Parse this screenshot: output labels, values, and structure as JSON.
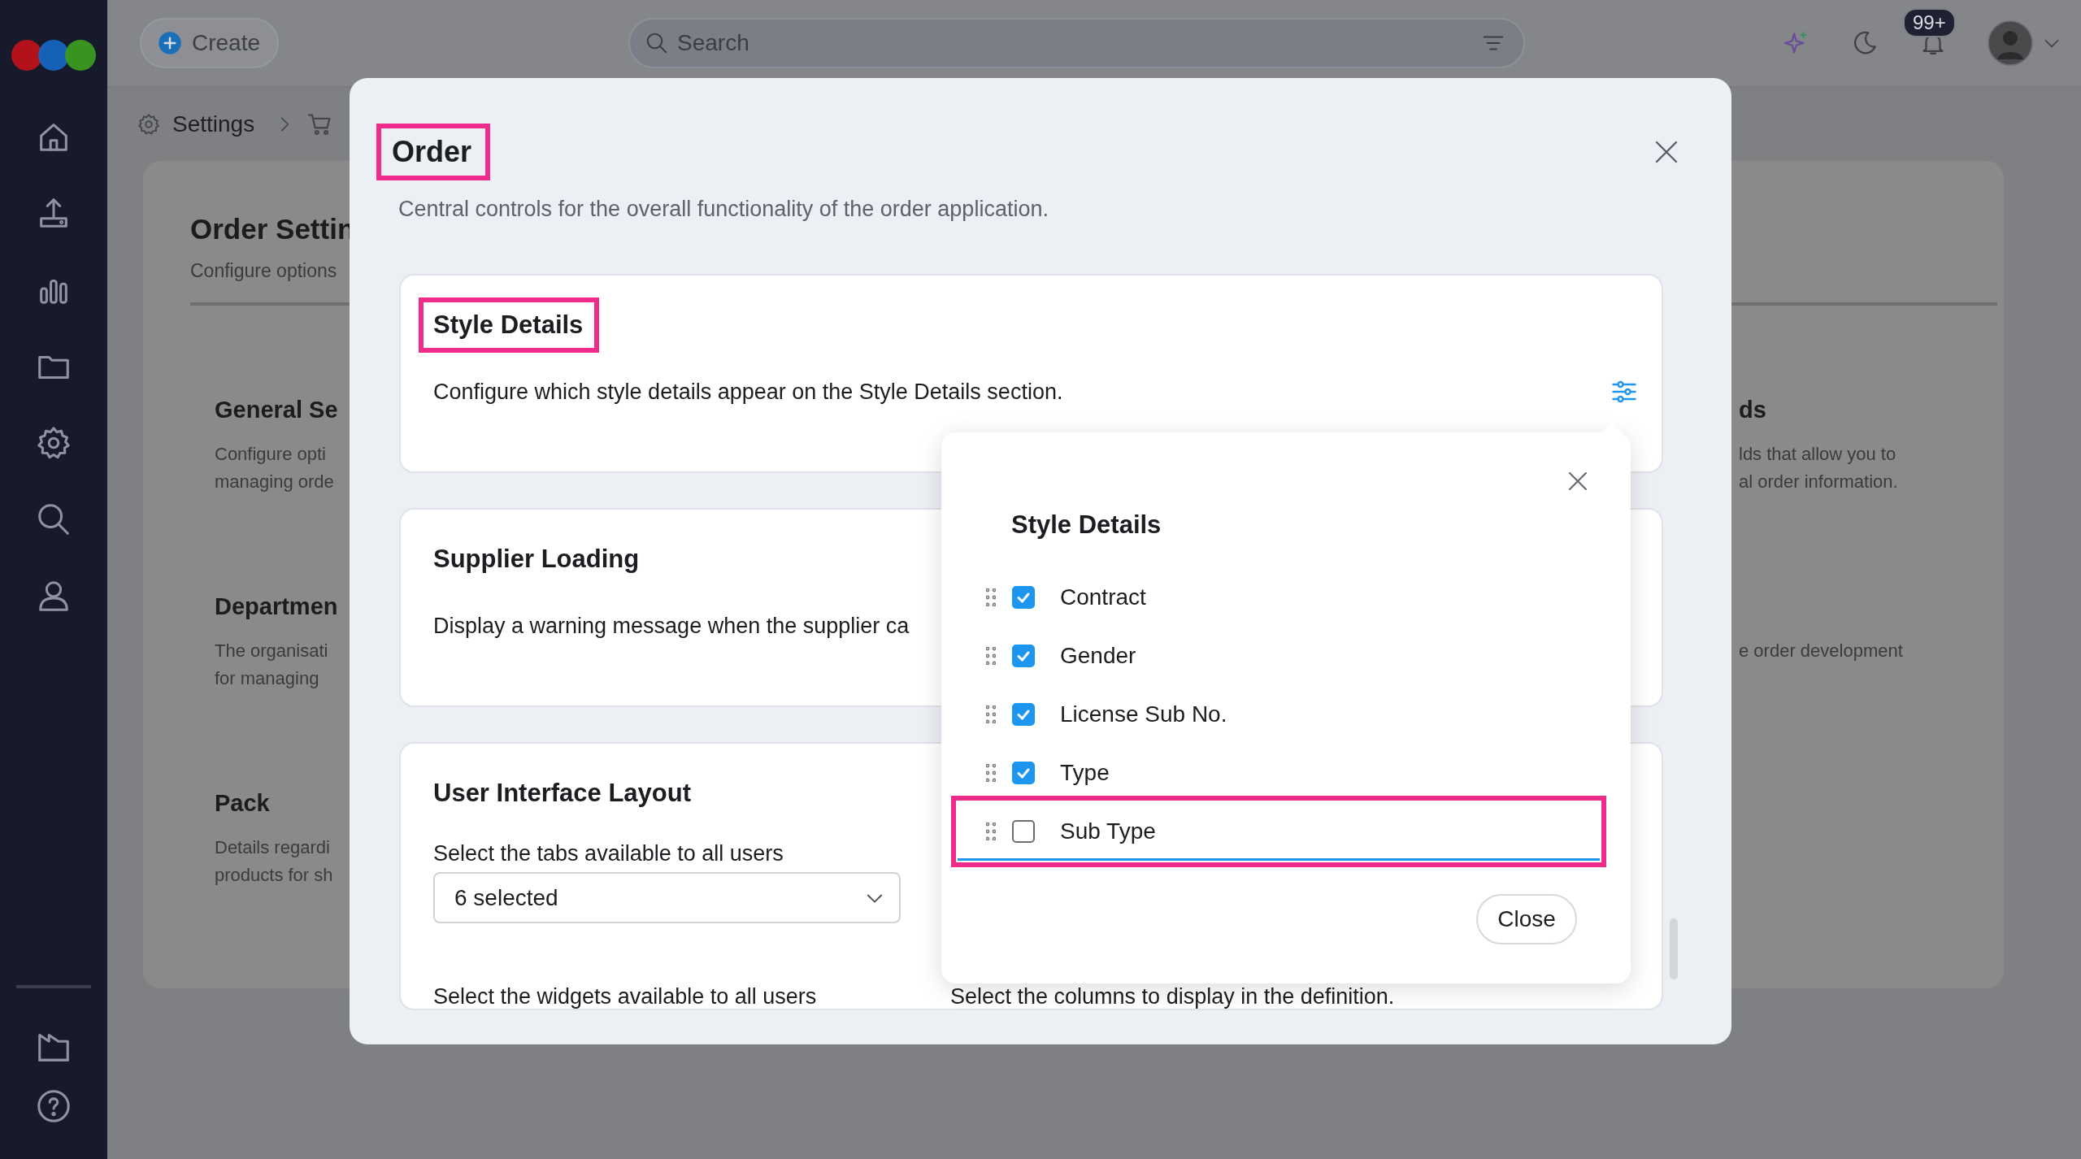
{
  "app": {
    "create_button": "Create",
    "search": {
      "placeholder": "Search"
    },
    "notification_badge": "99+"
  },
  "breadcrumb": {
    "items": [
      "Settings"
    ]
  },
  "page": {
    "title": "Order Settin",
    "subtitle": "Configure options",
    "sections_left": [
      {
        "title": "General Se",
        "lines": [
          "Configure opti",
          "managing orde"
        ]
      },
      {
        "title": "Departmen",
        "lines": [
          "The organisati",
          "for managing"
        ]
      },
      {
        "title": "Pack",
        "lines": [
          "Details regardi",
          "products for sh"
        ]
      }
    ],
    "sections_right": [
      {
        "title": "ds",
        "lines": [
          "lds that allow you to",
          "al order information."
        ]
      },
      {
        "lines": [
          "e order development"
        ]
      }
    ]
  },
  "dialog": {
    "title": "Order",
    "title_highlighted": true,
    "description": "Central controls for the overall functionality of the order application.",
    "cards": [
      {
        "kind": "setting",
        "title": "Style Details",
        "highlighted": true,
        "options_button": true,
        "description": "Configure which style details appear on the Style Details section."
      },
      {
        "kind": "setting",
        "title": "Supplier Loading",
        "highlighted": false,
        "options_button": false,
        "description": "Display a warning message when the supplier ca"
      },
      {
        "kind": "form",
        "title": "User Interface Layout",
        "highlighted": false,
        "rows": [
          [
            {
              "label": "Select the tabs available to all users",
              "value": "6 selected"
            }
          ],
          [
            {
              "label": "Select the widgets available to all users"
            },
            {
              "label": "Select the columns to display in the definition."
            }
          ]
        ]
      }
    ],
    "popover": {
      "title": "Style Details",
      "items": [
        {
          "label": "Contract",
          "checked": true,
          "highlighted": false
        },
        {
          "label": "Gender",
          "checked": true,
          "highlighted": false
        },
        {
          "label": "License Sub No.",
          "checked": true,
          "highlighted": false
        },
        {
          "label": "Type",
          "checked": true,
          "highlighted": false
        },
        {
          "label": "Sub Type",
          "checked": false,
          "highlighted": true
        }
      ],
      "close_button": "Close"
    }
  }
}
